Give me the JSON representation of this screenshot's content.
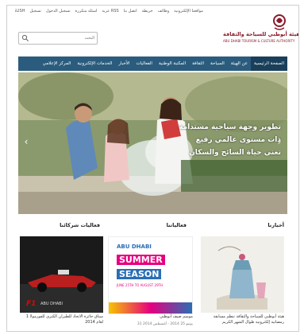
{
  "top_links": [
    "مواقعنا الإلكترونية",
    "وظائف",
    "خريطة",
    "اتصل بنا",
    "عربة RSS",
    "أسئلة متكررة",
    "تسجيل الدخول",
    "تسجيل",
    "ENGLISH"
  ],
  "logo": {
    "arabic": "هيئة أبوظبي للسياحة والثقافة",
    "english": "ABU DHABI TOURISM & CULTURE AUTHORITY"
  },
  "search": {
    "placeholder": "البحث"
  },
  "nav": [
    "الصفحة الرئيسية",
    "عن الهيئة",
    "السياحة",
    "الثقافة",
    "المكتبة الوطنية",
    "الفعاليات",
    "الأخبار",
    "الخدمات الإلكترونية",
    "المركز الإعلامي"
  ],
  "hero": {
    "caption_lines": [
      "تطوير وجهة سياحية مستدامة",
      "ذات مستوى عالمي رفيع",
      "تغني حياة السائح والسكان"
    ]
  },
  "sections": {
    "news": {
      "heading": "أخبارنا",
      "caption": "هيئة أبوظبي للسياحة والثقافة تنظم مسابقة رمضانية إلكترونية طوال الشهر الكريم"
    },
    "events": {
      "heading": "فعالياتنا",
      "caption": "موسم صيف أبوظبي",
      "dates": "يونيو 25 2014 - أغسطس 2014 31",
      "banner": {
        "line1": "ABU DHABI",
        "line2": "SUMMER",
        "line3": "SEASON",
        "line4": "JUNE 25TH TO AUGUST 29TH"
      }
    },
    "partners": {
      "heading": "فعاليات شركائنا",
      "caption": "سباق جائزة الاتحاد للطيران الكبرى للفورمولا 1 لعام 2014",
      "poster": {
        "brand": "F1",
        "sub": "ABU DHABI"
      }
    }
  },
  "colors": {
    "nav": "#2b5c7e",
    "nav_active": "#1a3f5a",
    "logo": "#8b1a2a",
    "summer_pink": "#e6007e",
    "summer_blue": "#2a6eb5"
  }
}
